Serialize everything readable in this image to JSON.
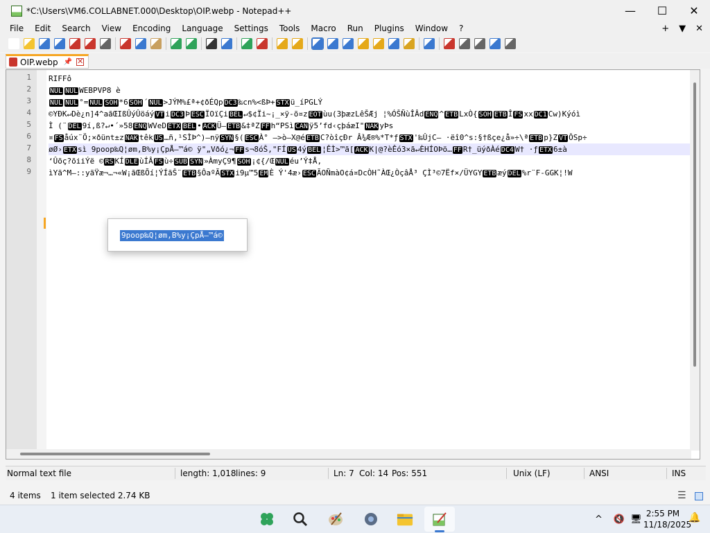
{
  "window": {
    "title": "*C:\\Users\\VM6.COLLABNET.000\\Desktop\\OIP.webp - Notepad++",
    "minimize": "—",
    "maximize": "☐",
    "close": "✕"
  },
  "menu": {
    "items": [
      "File",
      "Edit",
      "Search",
      "View",
      "Encoding",
      "Language",
      "Settings",
      "Tools",
      "Macro",
      "Run",
      "Plugins",
      "Window",
      "?"
    ],
    "right": [
      "+",
      "▼",
      "✕"
    ]
  },
  "toolbar": {
    "icons": [
      "new-file-icon",
      "open-file-icon",
      "save-icon",
      "save-all-icon",
      "close-icon",
      "close-all-icon",
      "print-icon",
      "cut-icon",
      "copy-icon",
      "paste-icon",
      "undo-icon",
      "redo-icon",
      "find-icon",
      "replace-icon",
      "zoom-in-icon",
      "zoom-out-icon",
      "sync-vertical-icon",
      "sync-horizontal-icon",
      "word-wrap-icon",
      "show-all-characters-icon",
      "indent-guide-icon",
      "user-defined-language-icon",
      "document-map-icon",
      "function-list-icon",
      "folder-as-workspace-icon",
      "monitoring-icon",
      "record-macro-icon",
      "stop-macro-icon",
      "play-macro-icon",
      "run-macro-multiple-icon",
      "save-macro-icon"
    ]
  },
  "tab": {
    "label": "OIP.webp",
    "pin": "📌",
    "close": "✕"
  },
  "editor": {
    "line_numbers": [
      "1",
      "2",
      "3",
      "4",
      "5",
      "6",
      "7",
      "8",
      "9"
    ],
    "lines": [
      [
        {
          "t": "RIFFô"
        }
      ],
      [
        {
          "c": "NUL"
        },
        {
          "c": "NUL"
        },
        {
          "t": "WEBPVP8 è"
        }
      ],
      [
        {
          "c": "NUL"
        },
        {
          "c": "NUL"
        },
        {
          "t": "°="
        },
        {
          "c": "NUL"
        },
        {
          "c": "SOH"
        },
        {
          "t": "*6"
        },
        {
          "c": "SOH"
        },
        {
          "t": "´"
        },
        {
          "c": "NUL"
        },
        {
          "t": ">JÝM%£ª+¢ðÉQp"
        },
        {
          "c": "DC3"
        },
        {
          "t": "‰cn%<ßÞ+"
        },
        {
          "c": "STX"
        },
        {
          "t": "ü_íPGLÝ"
        }
      ],
      [
        {
          "t": "©YÐK↵Dè¿n]4^aãŒIßÛýÛöáý"
        },
        {
          "c": "VT"
        },
        {
          "t": "i"
        },
        {
          "c": "DC3"
        },
        {
          "t": "Þ"
        },
        {
          "c": "ESC"
        },
        {
          "t": "ÏOïÇi"
        },
        {
          "c": "BEL"
        },
        {
          "t": "↵$¢Ïi~¡_×ÿ-õ¤z"
        },
        {
          "c": "EOT"
        },
        {
          "t": "ùu(3þæzLêŠÆj ¦%ÓŠÑùÎÂd"
        },
        {
          "c": "ENQ"
        },
        {
          "t": "^"
        },
        {
          "c": "ETB"
        },
        {
          "t": "LxÒ{"
        },
        {
          "c": "SOH"
        },
        {
          "c": "ETB"
        },
        {
          "t": "Î"
        },
        {
          "c": "FS"
        },
        {
          "t": "xx"
        },
        {
          "c": "DC1"
        },
        {
          "t": "Cw)Kýóì"
        }
      ],
      [
        {
          "t": "Ì (¨"
        },
        {
          "c": "DEL"
        },
        {
          "t": "9í,ß?↵•´»58"
        },
        {
          "c": "ENQ"
        },
        {
          "t": "WVeD"
        },
        {
          "c": "ETX"
        },
        {
          "c": "BEL"
        },
        {
          "t": "•"
        },
        {
          "c": "ACK"
        },
        {
          "t": "Ü–"
        },
        {
          "c": "ETB"
        },
        {
          "t": "&‡ªZ"
        },
        {
          "c": "FF"
        },
        {
          "t": "h“PSì"
        },
        {
          "c": "CAN"
        },
        {
          "t": "ÿ5’fd‹çþáæI\""
        },
        {
          "c": "NAK"
        },
        {
          "t": "yÞs"
        }
      ],
      [
        {
          "t": "¤"
        },
        {
          "c": "FS"
        },
        {
          "t": "åúx¨Ö;×ðünt±z"
        },
        {
          "c": "NAK"
        },
        {
          "t": "têk"
        },
        {
          "c": "US"
        },
        {
          "t": "…ñ,¹SÌÞ^)–nÿ"
        },
        {
          "c": "SYN"
        },
        {
          "t": "§("
        },
        {
          "c": "ESC"
        },
        {
          "t": "À° –>ò–X@é"
        },
        {
          "c": "ETB"
        },
        {
          "t": "C?òîçÐr Â¾Æ®%*T*ƒ"
        },
        {
          "c": "STX"
        },
        {
          "t": "'‰ÛjC– ·ëî0^s:§†ßçe¿å»÷\\ª"
        },
        {
          "c": "ETB"
        },
        {
          "t": "p}Z"
        },
        {
          "c": "VT"
        },
        {
          "t": "ÔSp÷"
        }
      ],
      [
        {
          "t": "øØ›"
        },
        {
          "c": "ETX"
        },
        {
          "t": "sì    9poop‰Q¦øm,B%y¡ÇpÅ—™á©  ÿ\"„Vðó¿¬"
        },
        {
          "c": "FF"
        },
        {
          "t": "s¬8óŠ,\"FÍ"
        },
        {
          "c": "US"
        },
        {
          "t": "4ý"
        },
        {
          "c": "BEL"
        },
        {
          "t": "¦ÊÌ>™ã["
        },
        {
          "c": "ACK"
        },
        {
          "t": "K|@?èÊó3×ã↵ÈHÍOÞö…"
        },
        {
          "c": "FF"
        },
        {
          "t": "R†_üýðÀé"
        },
        {
          "c": "DC4"
        },
        {
          "t": "W† ·ƒ"
        },
        {
          "c": "ETX"
        },
        {
          "t": "6±à"
        }
      ],
      [
        {
          "t": "‘Ûõç?õiiÝë                                    ©"
        },
        {
          "c": "RS"
        },
        {
          "t": "KÍ"
        },
        {
          "c": "DLE"
        },
        {
          "t": "ùÍÂ"
        },
        {
          "c": "FS"
        },
        {
          "t": "ù÷"
        },
        {
          "c": "SUB"
        },
        {
          "c": "SYN"
        },
        {
          "t": "»ÀmyÇ9¶"
        },
        {
          "c": "SOH"
        },
        {
          "t": "¡¢{/Œ"
        },
        {
          "c": "NUL"
        },
        {
          "t": "éu’Ý‡Å,"
        }
      ],
      [
        {
          "t": "ìYã^M–::yãŸæ¬…¬«W¡ãŒßÕí¦ÝÍãŠ¨"
        },
        {
          "c": "ETB"
        },
        {
          "t": "§ÔaºÃ"
        },
        {
          "c": "STX"
        },
        {
          "t": "i9µ™5"
        },
        {
          "c": "EM"
        },
        {
          "t": "È Ý'4æ›"
        },
        {
          "c": "ESC"
        },
        {
          "t": "ÃOÑmàO¢á¤DcÒH˜ÀŒ¿ÒçâÅ³ ÇÌ³©7Ëf×/ÜYGY"
        },
        {
          "c": "ETB"
        },
        {
          "t": "æý"
        },
        {
          "c": "DEL"
        },
        {
          "t": "%r¨F-GGK¦!W"
        }
      ]
    ]
  },
  "autocomplete": {
    "selected": "9poop‰Q¦øm,B%y¡ÇpÅ—™á©"
  },
  "status": {
    "doc_type": "Normal text file",
    "length": "length: 1,018",
    "lines": "lines: 9",
    "ln": "Ln: 7",
    "col": "Col: 14",
    "pos": "Pos: 551",
    "eol": "Unix (LF)",
    "encoding": "ANSI",
    "mode": "INS"
  },
  "explorer": {
    "items": "4 items",
    "selected": "1 item selected  2.74 KB"
  },
  "taskbar": {
    "time": "2:55 PM",
    "date": "11/18/2025",
    "tray_chevron": "^"
  }
}
